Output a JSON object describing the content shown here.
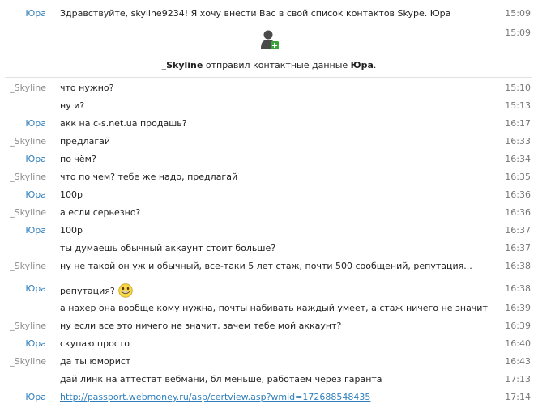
{
  "top": {
    "sender": "Юра",
    "text": "Здравствуйте, skyline9234! Я хочу внести Вас в свой список контактов Skype. Юра",
    "time": "15:09",
    "time2": "15:09"
  },
  "contact_share": {
    "from": "_Skyline",
    "middle": "отправил контактные данные",
    "to": "Юра",
    "end": "."
  },
  "messages": [
    {
      "sender": "_Skyline",
      "text": "что нужно?",
      "time": "15:10"
    },
    {
      "sender": "",
      "text": "ну и?",
      "time": "15:13"
    },
    {
      "sender": "Юра",
      "text": "акк на c-s.net.ua продашь?",
      "time": "16:17"
    },
    {
      "sender": "_Skyline",
      "text": "предлагай",
      "time": "16:33"
    },
    {
      "sender": "Юра",
      "text": "по чём?",
      "time": "16:34"
    },
    {
      "sender": "_Skyline",
      "text": "что по чем? тебе же надо, предлагай",
      "time": "16:35"
    },
    {
      "sender": "Юра",
      "text": "100р",
      "time": "16:36"
    },
    {
      "sender": "_Skyline",
      "text": "а если серьезно?",
      "time": "16:36"
    },
    {
      "sender": "Юра",
      "text": "100р",
      "time": "16:37"
    },
    {
      "sender": "",
      "text": "ты думаешь обычный аккаунт стоит больше?",
      "time": "16:37"
    },
    {
      "sender": "_Skyline",
      "text": "ну не такой он уж и обычный, все-таки 5 лет стаж, почти 500 сообщений, репутация...",
      "time": "16:38"
    },
    {
      "sender": "Юра",
      "text": "репутация?",
      "time": "16:38"
    },
    {
      "sender": "",
      "text": "а нахер она вообще кому нужна, почты набивать каждый умеет, а стаж ничего не значит",
      "time": "16:39"
    },
    {
      "sender": "_Skyline",
      "text": "ну если все это ничего не значит, зачем тебе мой аккаунт?",
      "time": "16:39"
    },
    {
      "sender": "Юра",
      "text": "скупаю просто",
      "time": "16:40"
    },
    {
      "sender": "_Skyline",
      "text": "да ты юморист",
      "time": "16:43"
    },
    {
      "sender": "",
      "text": "дай линк на аттестат вебмани, бл меньше, работаем через гаранта",
      "time": "17:13"
    },
    {
      "sender": "Юра",
      "text": "http://passport.webmoney.ru/asp/certview.asp?wmid=172688548435",
      "time": "17:14"
    }
  ],
  "icons": {
    "contact": "add-contact-icon",
    "smiley": "grinning-smiley-icon"
  },
  "colors": {
    "yura": "#2f7fbd",
    "skyline": "#8a8a8a",
    "time": "#777777"
  }
}
